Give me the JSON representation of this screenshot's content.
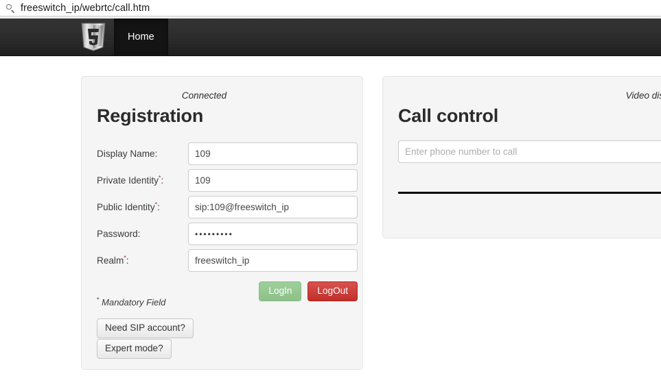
{
  "browser": {
    "search_icon": "search-icon",
    "url": "freeswitch_ip/webrtc/call.htm"
  },
  "navbar": {
    "brand_icon": "html5-shield-logo",
    "items": [
      {
        "label": "Home",
        "active": true
      }
    ]
  },
  "registration": {
    "status": "Connected",
    "title": "Registration",
    "fields": [
      {
        "label": "Display Name:",
        "required": false,
        "value": "109",
        "type": "text"
      },
      {
        "label": "Private Identity",
        "required": true,
        "value": "109",
        "type": "text"
      },
      {
        "label": "Public Identity",
        "required": true,
        "value": "sip:109@freeswitch_ip",
        "type": "text"
      },
      {
        "label": "Password:",
        "required": false,
        "value": "•••••••••",
        "type": "password"
      },
      {
        "label": "Realm",
        "required": true,
        "value": "freeswitch_ip",
        "type": "text"
      }
    ],
    "login_label": "LogIn",
    "logout_label": "LogOut",
    "mandatory_note": "Mandatory Field",
    "mandatory_star": "*",
    "need_sip_label": "Need SIP account?",
    "expert_mode_label": "Expert mode?"
  },
  "call_control": {
    "status": "Video disabled",
    "title": "Call control",
    "phone_placeholder": "Enter phone number to call",
    "phone_value": ""
  },
  "colors": {
    "navbar_dark": "#2b2b2b",
    "panel_bg": "#f5f5f5",
    "login_green": "#8dc189",
    "logout_red": "#c9302c",
    "divider_black": "#000000",
    "required_star": "#8a3b3b"
  }
}
